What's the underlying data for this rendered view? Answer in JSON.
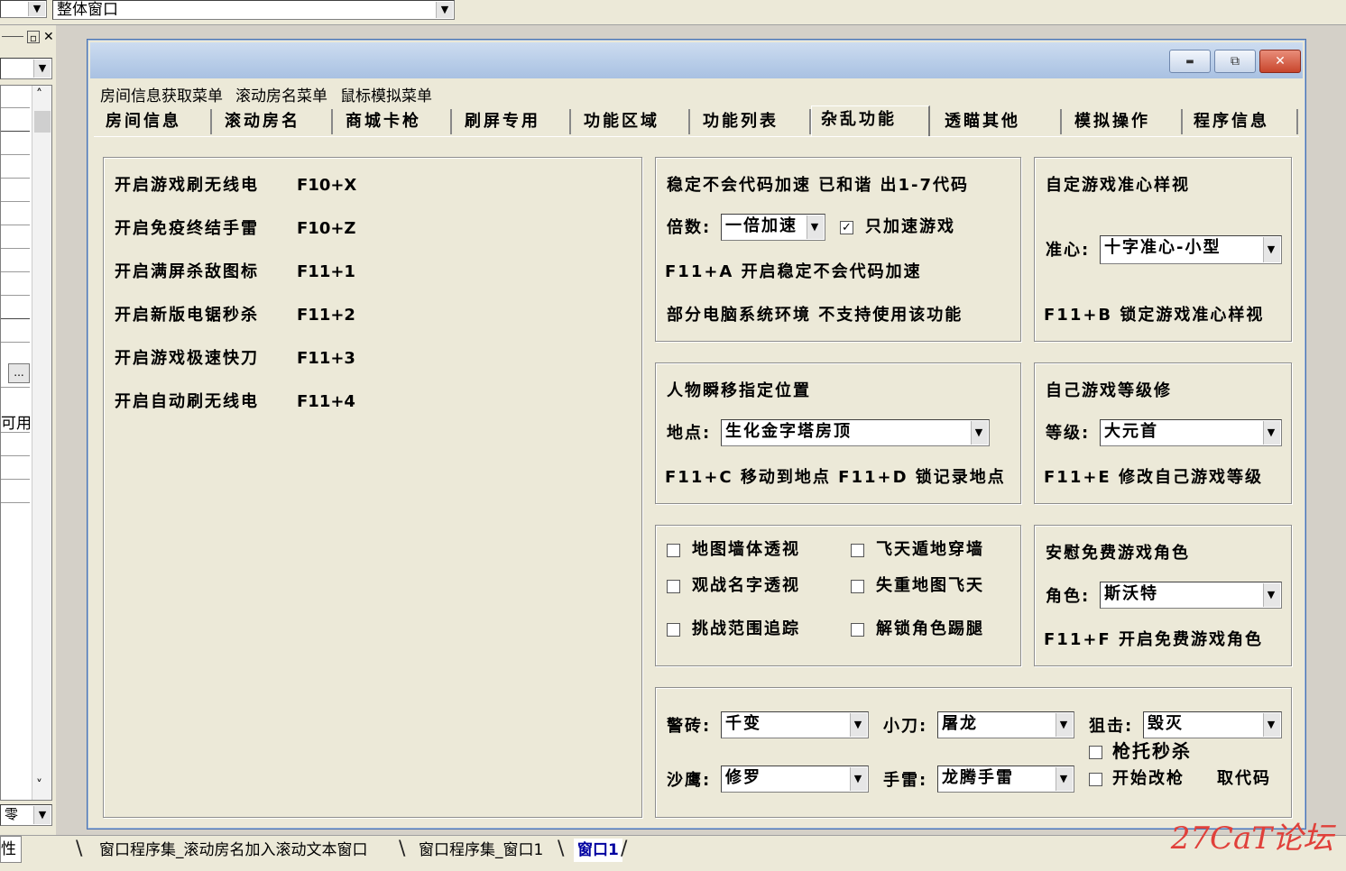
{
  "top_strip": {
    "object_combo": "整体窗口"
  },
  "side_panel": {
    "label_fragment": "可用",
    "label_fragment2": "零",
    "tab_fragment": "性",
    "ellipsis": "..."
  },
  "window": {
    "buttons": {
      "minimize": "▬",
      "restore": "⧉",
      "close": "✕"
    },
    "menus": [
      "房间信息获取菜单",
      "滚动房名菜单",
      "鼠标模拟菜单"
    ],
    "tabs": [
      "房间信息",
      "滚动房名",
      "商城卡枪",
      "刷屏专用",
      "功能区域",
      "功能列表",
      "杂乱功能",
      "透瞄其他",
      "模拟操作",
      "程序信息"
    ],
    "active_tab": "杂乱功能"
  },
  "left_group": {
    "items": [
      {
        "label": "开启游戏刷无线电",
        "hotkey": "F10+X"
      },
      {
        "label": "开启免疫终结手雷",
        "hotkey": "F10+Z"
      },
      {
        "label": "开启满屏杀敌图标",
        "hotkey": "F11+1"
      },
      {
        "label": "开启新版电锯秒杀",
        "hotkey": "F11+2"
      },
      {
        "label": "开启游戏极速快刀",
        "hotkey": "F11+3"
      },
      {
        "label": "开启自动刷无线电",
        "hotkey": "F11+4"
      }
    ]
  },
  "speed_group": {
    "title": "稳定不会代码加速 已和谐 出1-7代码",
    "multiplier_label": "倍数:",
    "multiplier_value": "一倍加速",
    "only_game_label": "只加速游戏",
    "only_game_checked": true,
    "hotkey_line": "F11+A 开启稳定不会代码加速",
    "note": "部分电脑系统环境 不支持使用该功能"
  },
  "crosshair_group": {
    "title": "自定游戏准心样视",
    "label": "准心:",
    "value": "十字准心-小型",
    "hotkey_line": "F11+B 锁定游戏准心样视"
  },
  "teleport_group": {
    "title": "人物瞬移指定位置",
    "label": "地点:",
    "value": "生化金字塔房顶",
    "hotkey_line": "F11+C 移动到地点 F11+D 锁记录地点"
  },
  "level_group": {
    "title": "自己游戏等级修",
    "label": "等级:",
    "value": "大元首",
    "hotkey_line": "F11+E 修改自己游戏等级"
  },
  "checkbox_group": {
    "items": [
      {
        "label": "地图墙体透视",
        "checked": false
      },
      {
        "label": "飞天遁地穿墙",
        "checked": false
      },
      {
        "label": "观战名字透视",
        "checked": false
      },
      {
        "label": "失重地图飞天",
        "checked": false
      },
      {
        "label": "挑战范围追踪",
        "checked": false
      },
      {
        "label": "解锁角色踢腿",
        "checked": false
      }
    ]
  },
  "role_group": {
    "title": "安慰免费游戏角色",
    "label": "角色:",
    "value": "斯沃特",
    "hotkey_line": "F11+F 开启免费游戏角色"
  },
  "weapon_group": {
    "brick_label": "警砖:",
    "brick_value": "千变",
    "knife_label": "小刀:",
    "knife_value": "屠龙",
    "sniper_label": "狙击:",
    "sniper_value": "毁灭",
    "sand_label": "沙鹰:",
    "sand_value": "修罗",
    "grenade_label": "手雷:",
    "grenade_value": "龙腾手雷",
    "butt_kill_label": "枪托秒杀",
    "butt_kill_checked": false,
    "start_mod_label": "开始改枪",
    "start_mod_checked": false,
    "get_code_label": "取代码"
  },
  "bottom_tabs": [
    "窗口程序集_滚动房名加入滚动文本窗口",
    "窗口程序集_窗口1",
    "窗口1"
  ],
  "watermark": "27CaT论坛",
  "colors": {
    "window_bg": "#ece9d8",
    "title_gradient": "#b8cde8",
    "close_button": "#c8452c",
    "active_bottom_tab": "#0000a0"
  }
}
